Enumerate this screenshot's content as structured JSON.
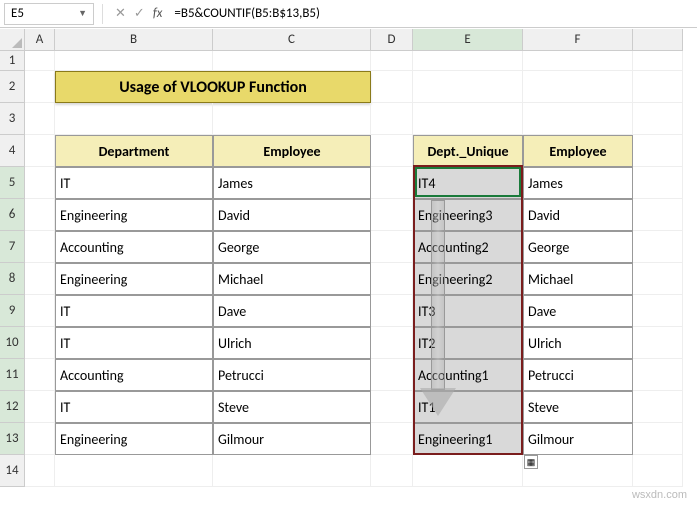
{
  "nameBox": "E5",
  "formula": "=B5&COUNTIF(B5:B$13,B5)",
  "cols": {
    "A": "A",
    "B": "B",
    "C": "C",
    "D": "D",
    "E": "E",
    "F": "F",
    "G": ""
  },
  "rows": [
    "1",
    "2",
    "3",
    "4",
    "5",
    "6",
    "7",
    "8",
    "9",
    "10",
    "11",
    "12",
    "13",
    "14"
  ],
  "title": "Usage of VLOOKUP Function",
  "headers": {
    "dept": "Department",
    "emp": "Employee",
    "deptU": "Dept._Unique",
    "emp2": "Employee"
  },
  "table1": [
    {
      "dept": "IT",
      "emp": "James"
    },
    {
      "dept": "Engineering",
      "emp": "David"
    },
    {
      "dept": "Accounting",
      "emp": "George"
    },
    {
      "dept": "Engineering",
      "emp": "Michael"
    },
    {
      "dept": "IT",
      "emp": "Dave"
    },
    {
      "dept": "IT",
      "emp": "Ulrich"
    },
    {
      "dept": "Accounting",
      "emp": "Petrucci"
    },
    {
      "dept": "IT",
      "emp": "Steve"
    },
    {
      "dept": "Engineering",
      "emp": "Gilmour"
    }
  ],
  "table2": [
    {
      "du": "IT4",
      "emp": "James"
    },
    {
      "du": "Engineering3",
      "emp": "David"
    },
    {
      "du": "Accounting2",
      "emp": "George"
    },
    {
      "du": "Engineering2",
      "emp": "Michael"
    },
    {
      "du": "IT3",
      "emp": "Dave"
    },
    {
      "du": "IT2",
      "emp": "Ulrich"
    },
    {
      "du": "Accounting1",
      "emp": "Petrucci"
    },
    {
      "du": "IT1",
      "emp": "Steve"
    },
    {
      "du": "Engineering1",
      "emp": "Gilmour"
    }
  ],
  "watermark": "wsxdn.com",
  "fxIcons": {
    "cancel": "✕",
    "enter": "✓",
    "fx": "fx"
  }
}
